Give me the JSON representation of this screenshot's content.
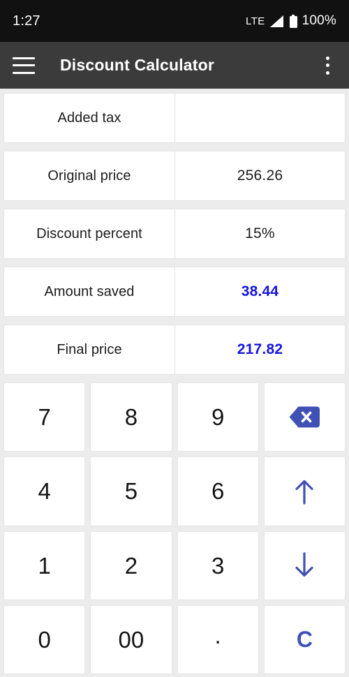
{
  "status_bar": {
    "time": "1:27",
    "network_type": "LTE",
    "signal_icon": "signal-bars-icon",
    "battery_icon": "battery-full-icon",
    "battery_percent": "100%"
  },
  "app_bar": {
    "menu_icon": "hamburger-menu-icon",
    "title": "Discount Calculator",
    "overflow_icon": "more-vertical-icon"
  },
  "colors": {
    "accent_blue": "#1515dd",
    "key_accent": "#3f51b5",
    "app_bar_bg": "#3b3b3b",
    "status_bar_bg": "#111112",
    "page_bg": "#ececec",
    "card_bg": "#ffffff"
  },
  "rows": [
    {
      "label": "Added tax",
      "value": "",
      "highlight": false
    },
    {
      "label": "Original price",
      "value": "256.26",
      "highlight": false
    },
    {
      "label": "Discount percent",
      "value": "15%",
      "highlight": false
    },
    {
      "label": "Amount saved",
      "value": "38.44",
      "highlight": true
    },
    {
      "label": "Final price",
      "value": "217.82",
      "highlight": true
    }
  ],
  "keypad": [
    {
      "label": "7",
      "name": "key-7",
      "type": "digit"
    },
    {
      "label": "8",
      "name": "key-8",
      "type": "digit"
    },
    {
      "label": "9",
      "name": "key-9",
      "type": "digit"
    },
    {
      "label": "",
      "name": "key-backspace",
      "type": "backspace"
    },
    {
      "label": "4",
      "name": "key-4",
      "type": "digit"
    },
    {
      "label": "5",
      "name": "key-5",
      "type": "digit"
    },
    {
      "label": "6",
      "name": "key-6",
      "type": "digit"
    },
    {
      "label": "",
      "name": "key-arrow-up",
      "type": "arrow-up"
    },
    {
      "label": "1",
      "name": "key-1",
      "type": "digit"
    },
    {
      "label": "2",
      "name": "key-2",
      "type": "digit"
    },
    {
      "label": "3",
      "name": "key-3",
      "type": "digit"
    },
    {
      "label": "",
      "name": "key-arrow-down",
      "type": "arrow-down"
    },
    {
      "label": "0",
      "name": "key-0",
      "type": "digit"
    },
    {
      "label": "00",
      "name": "key-00",
      "type": "digit"
    },
    {
      "label": ".",
      "name": "key-decimal",
      "type": "dot"
    },
    {
      "label": "C",
      "name": "key-clear",
      "type": "clear"
    }
  ]
}
